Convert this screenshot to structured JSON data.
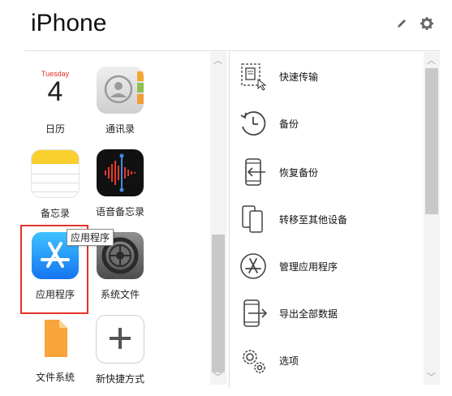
{
  "header": {
    "title": "iPhone",
    "icons": [
      "edit-icon",
      "gear-icon"
    ]
  },
  "apps": [
    {
      "label": "日历",
      "calendar_day": "Tuesday",
      "calendar_date": "4"
    },
    {
      "label": "通讯录"
    },
    {
      "label": "备忘录"
    },
    {
      "label": "语音备忘录"
    },
    {
      "label": "应用程序",
      "tooltip": "应用程序"
    },
    {
      "label": "系统文件"
    },
    {
      "label": "文件系统"
    },
    {
      "label": "新快捷方式"
    }
  ],
  "actions": [
    {
      "label": "快速传输",
      "icon": "quick-transfer-icon"
    },
    {
      "label": "备份",
      "icon": "backup-icon"
    },
    {
      "label": "恢复备份",
      "icon": "restore-icon"
    },
    {
      "label": "转移至其他设备",
      "icon": "transfer-device-icon"
    },
    {
      "label": "管理应用程序",
      "icon": "app-store-icon"
    },
    {
      "label": "导出全部数据",
      "icon": "export-icon"
    },
    {
      "label": "选项",
      "icon": "gears-icon"
    }
  ],
  "colors": {
    "highlight": "#e5322c",
    "calendar_red": "#e2312d",
    "app_blue": "#1574f2"
  }
}
